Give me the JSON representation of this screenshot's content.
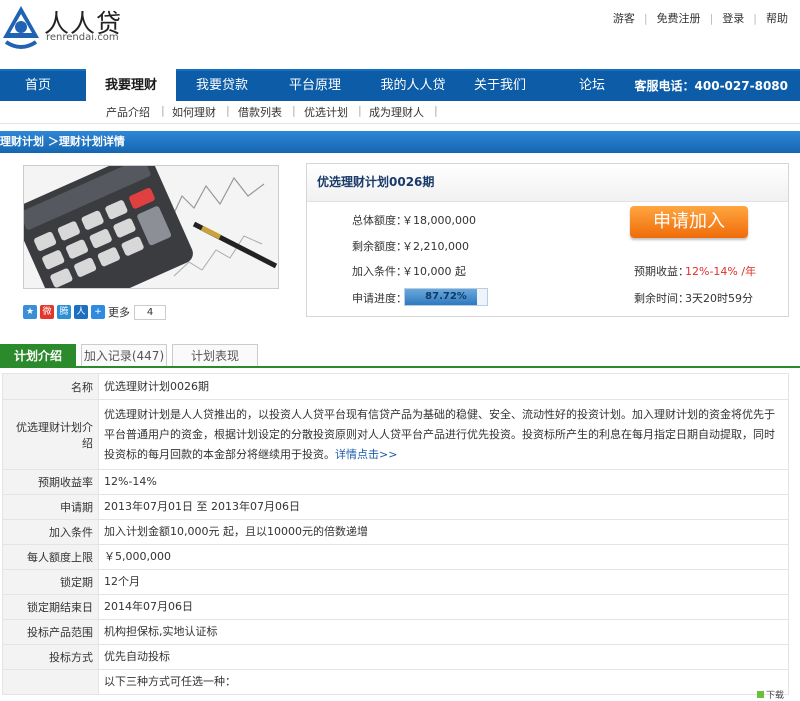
{
  "brand": {
    "name_cn": "人人贷",
    "name_en": "renrendai.com"
  },
  "toplinks": [
    "游客",
    "免费注册",
    "登录",
    "帮助"
  ],
  "nav": {
    "items": [
      "首页",
      "我要理财",
      "我要贷款",
      "平台原理",
      "我的人人贷",
      "关于我们",
      "论坛"
    ],
    "active_index": 1,
    "hotline": "客服电话：400-027-8080"
  },
  "subnav": [
    "产品介绍",
    "如何理财",
    "借款列表",
    "优选计划",
    "成为理财人"
  ],
  "breadcrumb": "理财计划 ＞理财计划详情",
  "plan": {
    "title": "优选理财计划0026期",
    "total_label": "总体额度：",
    "total_value": "￥18,000,000",
    "remaining_label": "剩余额度：",
    "remaining_value": "￥2,210,000",
    "condition_label": "加入条件：",
    "condition_value": "￥10,000 起",
    "progress_label": "申请进度：",
    "progress_value": "87.72%",
    "progress_fraction": 0.8772,
    "apply_button": "申请加入",
    "expected_label": "预期收益：",
    "expected_value": "12%-14% /年",
    "time_label": "剩余时间：",
    "time_value": "3天20时59分"
  },
  "share": {
    "more_label": "更多",
    "count": "4"
  },
  "tabs": [
    "计划介绍",
    "加入记录(447)",
    "计划表现"
  ],
  "details": {
    "name_k": "名称",
    "name_v": "优选理财计划0026期",
    "intro_k": "优选理财计划介绍",
    "intro_v": "优选理财计划是人人贷推出的，以投资人人贷平台现有信贷产品为基础的稳健、安全、流动性好的投资计划。加入理财计划的资金将优先于平台普通用户的资金，根据计划设定的分散投资原则对人人贷平台产品进行优先投资。投资标所产生的利息在每月指定日期自动提取，同时投资标的每月回款的本金部分将继续用于投资。",
    "intro_link": "详情点击>>",
    "rate_k": "预期收益率",
    "rate_v": "12%-14%",
    "period_k": "申请期",
    "period_v": "2013年07月01日 至 2013年07月06日",
    "join_k": "加入条件",
    "join_v": "加入计划金额10,000元 起，且以10000元的倍数递增",
    "limit_k": "每人额度上限",
    "limit_v": "￥5,000,000",
    "lock_k": "锁定期",
    "lock_v": "12个月",
    "lockend_k": "锁定期结束日",
    "lockend_v": "2014年07月06日",
    "scope_k": "投标产品范围",
    "scope_v": "机构担保标,实地认证标",
    "method_k": "投标方式",
    "method_v": "优先自动投标",
    "last_v": "以下三种方式可任选一种："
  },
  "bottom_hint": "下载",
  "colors": {
    "nav": "#0c5ca8",
    "accent_orange": "#ef6c0a",
    "tab_green": "#2b8a2b",
    "rate_red": "#e0302a"
  }
}
